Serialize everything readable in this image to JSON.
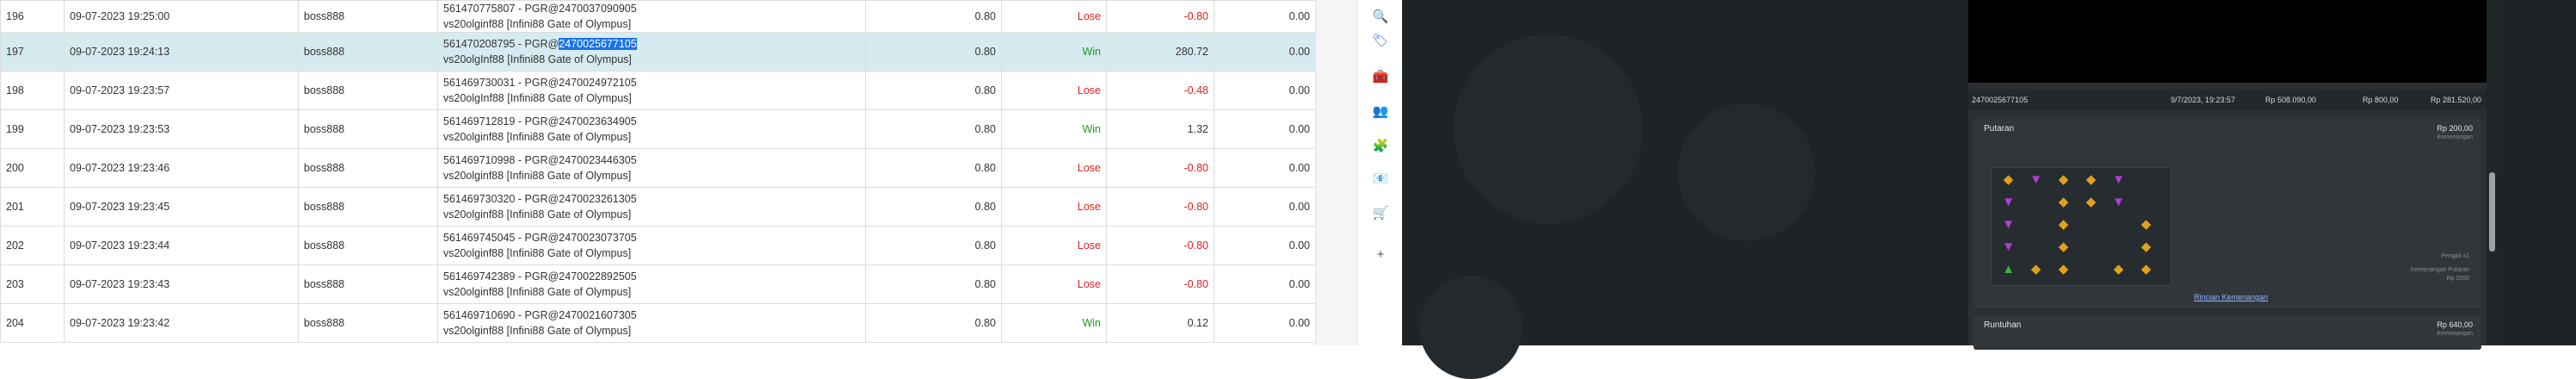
{
  "rows": [
    {
      "no": "196",
      "date": "09-07-2023 19:25:00",
      "user": "boss888",
      "desc_line1": "561470775807 - PGR@2470037090905",
      "desc_line2": "vs20olginf88 [Infini88 Gate of Olympus]",
      "bet": "0.80",
      "result": "Lose",
      "win": "-0.80",
      "extra": "0.00"
    },
    {
      "no": "197",
      "date": "09-07-2023 19:24:13",
      "user": "boss888",
      "desc_prefix": "561470208795 - PGR@",
      "desc_highlight": "2470025677105",
      "desc_line2": "vs20olgInf88 [Infini88 Gate of Olympus]",
      "bet": "0.80",
      "result": "Win",
      "win": "280.72",
      "extra": "0.00"
    },
    {
      "no": "198",
      "date": "09-07-2023 19:23:57",
      "user": "boss888",
      "desc_line1": "561469730031 - PGR@2470024972105",
      "desc_line2": "vs20olgInf88 [Infini88 Gate of Olympus]",
      "bet": "0.80",
      "result": "Lose",
      "win": "-0.48",
      "extra": "0.00"
    },
    {
      "no": "199",
      "date": "09-07-2023 19:23:53",
      "user": "boss888",
      "desc_line1": "561469712819 - PGR@2470023634905",
      "desc_line2": "vs20olginf88 [Infini88 Gate of Olympus]",
      "bet": "0.80",
      "result": "Win",
      "win": "1.32",
      "extra": "0.00"
    },
    {
      "no": "200",
      "date": "09-07-2023 19:23:46",
      "user": "boss888",
      "desc_line1": "561469710998 - PGR@2470023446305",
      "desc_line2": "vs20olginf88 [Infini88 Gate of Olympus]",
      "bet": "0.80",
      "result": "Lose",
      "win": "-0.80",
      "extra": "0.00"
    },
    {
      "no": "201",
      "date": "09-07-2023 19:23:45",
      "user": "boss888",
      "desc_line1": "561469730320 - PGR@2470023261305",
      "desc_line2": "vs20olginf88 [Infini88 Gate of Olympus]",
      "bet": "0.80",
      "result": "Lose",
      "win": "-0.80",
      "extra": "0.00"
    },
    {
      "no": "202",
      "date": "09-07-2023 19:23:44",
      "user": "boss888",
      "desc_line1": "561469745045 - PGR@2470023073705",
      "desc_line2": "vs20olginf88 [Infini88 Gate of Olympus]",
      "bet": "0.80",
      "result": "Lose",
      "win": "-0.80",
      "extra": "0.00"
    },
    {
      "no": "203",
      "date": "09-07-2023 19:23:43",
      "user": "boss888",
      "desc_line1": "561469742389 - PGR@2470022892505",
      "desc_line2": "vs20olginf88 [Infini88 Gate of Olympus]",
      "bet": "0.80",
      "result": "Lose",
      "win": "-0.80",
      "extra": "0.00"
    },
    {
      "no": "204",
      "date": "09-07-2023 19:23:42",
      "user": "boss888",
      "desc_line1": "561469710690 - PGR@2470021607305",
      "desc_line2": "vs20olginf88 [Infini88 Gate of Olympus]",
      "bet": "0.80",
      "result": "Win",
      "win": "0.12",
      "extra": "0.00"
    }
  ],
  "sidebar_icons": [
    "search-icon",
    "tag-icon",
    "toolbox-icon",
    "people-icon",
    "extension-icon",
    "outlook-icon",
    "cart-icon",
    "plus-icon"
  ],
  "sidebar_glyphs": [
    "🔍",
    "🏷",
    "🧰",
    "👥",
    "🧩",
    "📧",
    "🛒",
    "+"
  ],
  "game": {
    "info": {
      "id": "2470025677105",
      "date": "9/7/2023, 19:23:57",
      "bet": "Rp 508.090,00",
      "stake": "Rp 800,00",
      "total": "Rp 281.520,00"
    },
    "spin_card": {
      "title": "Putaran",
      "amount": "Rp 200,00",
      "amount_sub": "Kemenangan",
      "multiplier_label": "Pengali x1",
      "win_label": "Kemenangan Putaran",
      "win_value": "Rp 2000",
      "link": "Rincian Kemenangan"
    },
    "tumble_card": {
      "title": "Runtuhan",
      "amount": "Rp 640,00",
      "amount_sub": "Kemenangan"
    }
  },
  "colors": {
    "win": "#1f9a1f",
    "lose": "#e02020",
    "selected_row": "#d6ebf0",
    "highlight": "#1a73e8"
  }
}
